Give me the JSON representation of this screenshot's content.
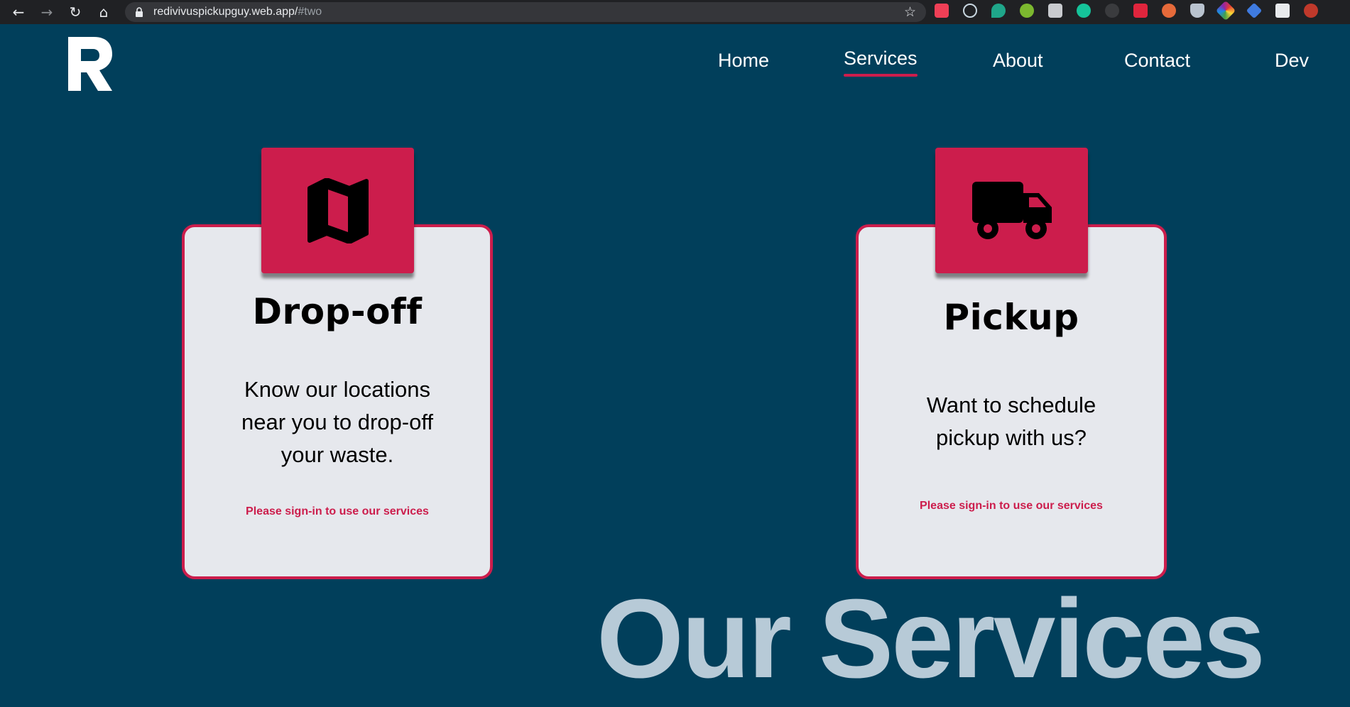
{
  "browser": {
    "back_icon": "←",
    "forward_icon": "→",
    "reload_icon": "↻",
    "home_icon": "⌂",
    "url_host": "redivivuspickupguy.web.app/",
    "url_path": "#two",
    "bookmark_icon": "☆"
  },
  "nav": {
    "items": [
      {
        "label": "Home"
      },
      {
        "label": "Services",
        "active": true
      },
      {
        "label": "About"
      },
      {
        "label": "Contact"
      },
      {
        "label": "Dev"
      }
    ]
  },
  "cards": [
    {
      "icon": "map-icon",
      "title": "Drop-off",
      "description": "Know our locations near you to drop-off your waste.",
      "signin": "Please sign-in to use our services"
    },
    {
      "icon": "truck-icon",
      "title": "Pickup",
      "description": "Want to schedule pickup with us?",
      "signin": "Please sign-in to use our services"
    }
  ],
  "section_title": "Our Services",
  "colors": {
    "background": "#013f5b",
    "accent": "#cc1d4c",
    "card": "#e6e8ed",
    "heading_faded": "#b7cad7"
  }
}
